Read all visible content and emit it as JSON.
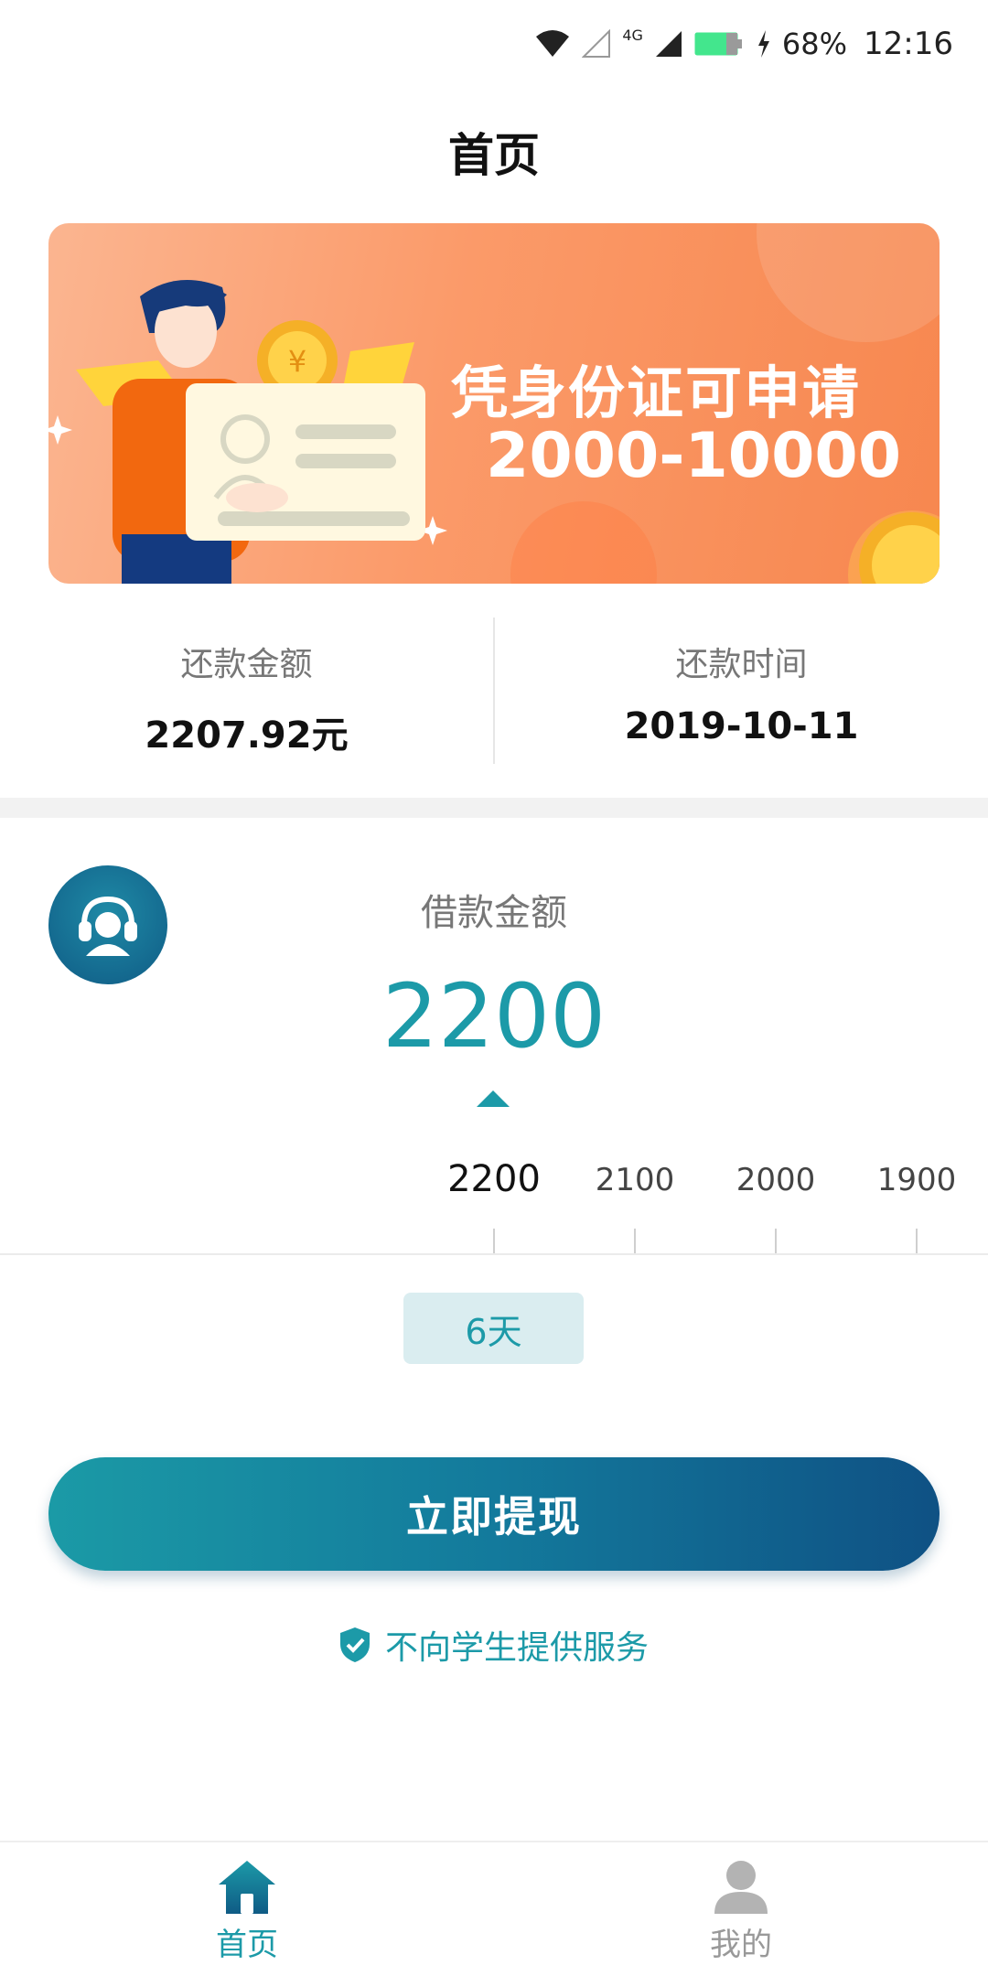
{
  "status_bar": {
    "network": "4G",
    "battery": "68%",
    "time": "12:16"
  },
  "page": {
    "title": "首页"
  },
  "banner": {
    "line1": "凭身份证可申请",
    "line2": "2000-10000"
  },
  "repay": {
    "amount_label": "还款金额",
    "amount_value": "2207.92元",
    "date_label": "还款时间",
    "date_value": "2019-10-11"
  },
  "loan": {
    "label": "借款金额",
    "amount": "2200",
    "ruler": [
      "2200",
      "2100",
      "2000",
      "1900"
    ],
    "selected_index": 0,
    "term": "6天"
  },
  "actions": {
    "withdraw_label": "立即提现"
  },
  "notice": {
    "text": "不向学生提供服务"
  },
  "nav": {
    "items": [
      {
        "label": "首页",
        "icon": "home-icon",
        "active": true
      },
      {
        "label": "我的",
        "icon": "user-icon",
        "active": false
      }
    ]
  },
  "colors": {
    "accent": "#1c9aa8",
    "button_gradient_start": "#1b9aa6",
    "button_gradient_end": "#0f5184",
    "banner_orange": "#f7874f"
  }
}
